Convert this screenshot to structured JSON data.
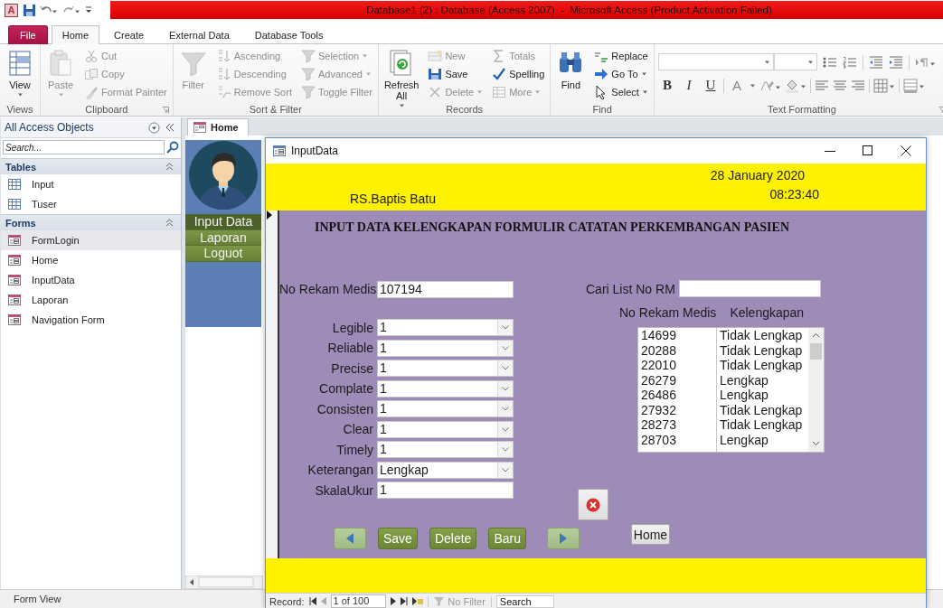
{
  "title_bar": {
    "logo": "A",
    "title": "Database1 (2) : Database (Access 2007)  -  Microsoft Access (Product Activation Failed)"
  },
  "ribbon_tabs": [
    {
      "label": "File",
      "kind": "file",
      "selected": false
    },
    {
      "label": "Home",
      "kind": "tab",
      "selected": true
    },
    {
      "label": "Create",
      "kind": "tab",
      "selected": false
    },
    {
      "label": "External Data",
      "kind": "tab",
      "selected": false
    },
    {
      "label": "Database Tools",
      "kind": "tab",
      "selected": false
    }
  ],
  "ribbon_groups": [
    {
      "label": "Views",
      "kind": "commands",
      "launcher": false,
      "columns": [
        [
          {
            "label": "View",
            "kind": "large",
            "disabled": false,
            "dropdown": true
          }
        ]
      ]
    },
    {
      "label": "Clipboard",
      "kind": "commands",
      "launcher": true,
      "columns": [
        [
          {
            "label": "Paste",
            "kind": "large",
            "disabled": true,
            "dropdown": true
          }
        ],
        [
          {
            "label": "Cut",
            "kind": "small",
            "disabled": true,
            "dropdown": false
          },
          {
            "label": "Copy",
            "kind": "small",
            "disabled": true,
            "dropdown": false
          },
          {
            "label": "Format Painter",
            "kind": "small",
            "disabled": true,
            "dropdown": false
          }
        ]
      ]
    },
    {
      "label": "Sort & Filter",
      "kind": "commands",
      "launcher": false,
      "columns": [
        [
          {
            "label": "Filter",
            "kind": "large",
            "disabled": true,
            "dropdown": false
          }
        ],
        [
          {
            "label": "Ascending",
            "kind": "small",
            "disabled": true,
            "dropdown": false
          },
          {
            "label": "Descending",
            "kind": "small",
            "disabled": true,
            "dropdown": false
          },
          {
            "label": "Remove Sort",
            "kind": "small",
            "disabled": true,
            "dropdown": false
          }
        ],
        [
          {
            "label": "Selection",
            "kind": "small",
            "disabled": true,
            "dropdown": true
          },
          {
            "label": "Advanced",
            "kind": "small",
            "disabled": true,
            "dropdown": true
          },
          {
            "label": "Toggle Filter",
            "kind": "small",
            "disabled": true,
            "dropdown": false
          }
        ]
      ]
    },
    {
      "label": "Records",
      "kind": "commands",
      "launcher": false,
      "columns": [
        [
          {
            "label": "Refresh All",
            "kind": "large",
            "disabled": false,
            "dropdown": true
          }
        ],
        [
          {
            "label": "New",
            "kind": "small",
            "disabled": true,
            "dropdown": false
          },
          {
            "label": "Save",
            "kind": "small",
            "disabled": false,
            "dropdown": false
          },
          {
            "label": "Delete",
            "kind": "small",
            "disabled": true,
            "dropdown": true
          }
        ],
        [
          {
            "label": "Totals",
            "kind": "small",
            "disabled": true,
            "dropdown": false
          },
          {
            "label": "Spelling",
            "kind": "small",
            "disabled": false,
            "dropdown": false
          },
          {
            "label": "More",
            "kind": "small",
            "disabled": true,
            "dropdown": true
          }
        ]
      ]
    },
    {
      "label": "Find",
      "kind": "commands",
      "launcher": false,
      "columns": [
        [
          {
            "label": "Find",
            "kind": "large",
            "disabled": false,
            "dropdown": false
          }
        ],
        [
          {
            "label": "Replace",
            "kind": "small",
            "disabled": false,
            "dropdown": false
          },
          {
            "label": "Go To",
            "kind": "small",
            "disabled": false,
            "dropdown": true
          },
          {
            "label": "Select",
            "kind": "small",
            "disabled": false,
            "dropdown": true
          }
        ]
      ]
    },
    {
      "label": "Text Formatting",
      "kind": "formatting",
      "launcher": true,
      "letters": [
        "B",
        "I",
        "U",
        "A"
      ]
    }
  ],
  "navigation_pane": {
    "title": "All Access Objects",
    "search_placeholder": "Search...",
    "groups": [
      {
        "label": "Tables",
        "kind": "table",
        "expanded": true,
        "items": [
          {
            "label": "Input",
            "selected": false
          },
          {
            "label": "Tuser",
            "selected": false
          }
        ]
      },
      {
        "label": "Forms",
        "kind": "form",
        "expanded": true,
        "items": [
          {
            "label": "FormLogin",
            "selected": true
          },
          {
            "label": "Home",
            "selected": false
          },
          {
            "label": "InputData",
            "selected": false
          },
          {
            "label": "Laporan",
            "selected": false
          },
          {
            "label": "Navigation Form",
            "selected": false
          }
        ]
      }
    ]
  },
  "document_tabs": [
    {
      "label": "Home",
      "selected": true
    }
  ],
  "home_form": {
    "menu": [
      {
        "label": "Input Data",
        "selected": true
      },
      {
        "label": "Laporan",
        "selected": false
      },
      {
        "label": "Loguot",
        "selected": false
      }
    ]
  },
  "input_window": {
    "title": "InputData",
    "header": {
      "date": "28 January 2020",
      "time": "08:23:40",
      "hospital": "RS.Baptis Batu"
    },
    "heading": "INPUT DATA KELENGKAPAN FORMULIR CATATAN PERKEMBANGAN PASIEN",
    "fields": [
      {
        "label": "No Rekam Medis",
        "value": "107194",
        "kind": "text"
      },
      {
        "label": "Legible",
        "value": "1",
        "kind": "combo"
      },
      {
        "label": "Reliable",
        "value": "1",
        "kind": "combo"
      },
      {
        "label": "Precise",
        "value": "1",
        "kind": "combo"
      },
      {
        "label": "Complate",
        "value": "1",
        "kind": "combo"
      },
      {
        "label": "Consisten",
        "value": "1",
        "kind": "combo"
      },
      {
        "label": "Clear",
        "value": "1",
        "kind": "combo"
      },
      {
        "label": "Timely",
        "value": "1",
        "kind": "combo"
      },
      {
        "label": "Keterangan",
        "value": "Lengkap",
        "kind": "combo"
      },
      {
        "label": "SkalaUkur",
        "value": "1",
        "kind": "text"
      }
    ],
    "search": {
      "label": "Cari List No RM"
    },
    "list": {
      "columns": [
        "No Rekam Medis",
        "Kelengkapan"
      ],
      "rows": [
        [
          "14699",
          "Tidak Lengkap"
        ],
        [
          "20288",
          "Tidak Lengkap"
        ],
        [
          "22010",
          "Tidak Lengkap"
        ],
        [
          "26279",
          "Lengkap"
        ],
        [
          "26486",
          "Lengkap"
        ],
        [
          "27932",
          "Tidak Lengkap"
        ],
        [
          "28273",
          "Tidak Lengkap"
        ],
        [
          "28703",
          "Lengkap"
        ]
      ]
    },
    "buttons": [
      {
        "kind": "previous"
      },
      {
        "kind": "action",
        "label": "Save"
      },
      {
        "kind": "action",
        "label": "Delete"
      },
      {
        "kind": "action",
        "label": "Baru"
      },
      {
        "kind": "next"
      }
    ],
    "home_button": {
      "label": "Home"
    },
    "record_navigator": {
      "label": "Record:",
      "position": "1 of 100",
      "filter": {
        "label": "No Filter",
        "disabled": true
      },
      "search_placeholder": "Search"
    }
  },
  "status_bar": {
    "text": "Form View"
  }
}
